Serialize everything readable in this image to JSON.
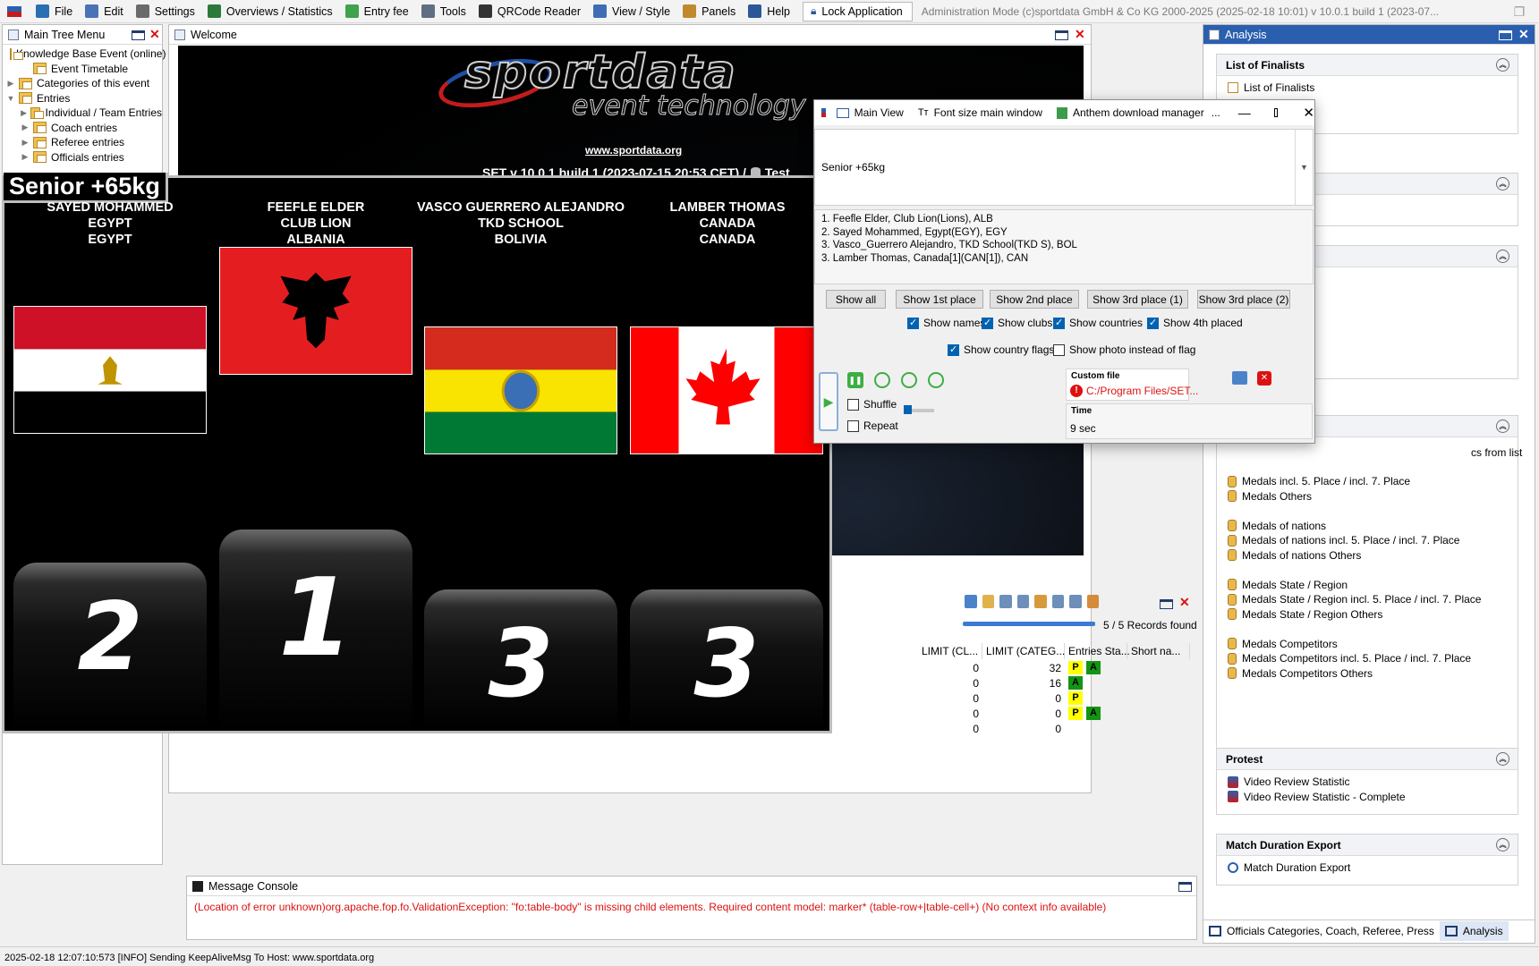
{
  "menu": {
    "items": [
      {
        "label": "File",
        "icon": "folder-icon",
        "color": "#2b6fb3"
      },
      {
        "label": "Edit",
        "icon": "edit-icon",
        "color": "#4a73b5"
      },
      {
        "label": "Settings",
        "icon": "gear-icon",
        "color": "#6a6a6a"
      },
      {
        "label": "Overviews / Statistics",
        "icon": "statistics-icon",
        "color": "#2b7a3a"
      },
      {
        "label": "Entry fee",
        "icon": "money-icon",
        "color": "#3ea34a"
      },
      {
        "label": "Tools",
        "icon": "wrench-icon",
        "color": "#5f6e82"
      },
      {
        "label": "QRCode Reader",
        "icon": "qrcode-icon",
        "color": "#333333"
      },
      {
        "label": "View / Style",
        "icon": "window-icon",
        "color": "#3f6db3"
      },
      {
        "label": "Panels",
        "icon": "panels-icon",
        "color": "#c08a2c"
      },
      {
        "label": "Help",
        "icon": "help-icon",
        "color": "#2b5797"
      }
    ],
    "lock_label": "Lock Application",
    "title": "Administration Mode (c)sportdata GmbH & Co KG 2000-2025 (2025-02-18 10:01)  v 10.0.1 build 1 (2023-07..."
  },
  "tree": {
    "title": "Main Tree Menu",
    "items": [
      {
        "label": "Knowledge Base Event (online)",
        "level": 0,
        "expander": ""
      },
      {
        "label": "Event Timetable",
        "level": 1,
        "expander": ""
      },
      {
        "label": "Categories of this event",
        "level": 0,
        "expander": "▶"
      },
      {
        "label": "Entries",
        "level": 0,
        "expander": "▼"
      },
      {
        "label": "Individual / Team Entries",
        "level": 1,
        "expander": "▶"
      },
      {
        "label": "Coach entries",
        "level": 1,
        "expander": "▶"
      },
      {
        "label": "Referee entries",
        "level": 1,
        "expander": "▶"
      },
      {
        "label": "Officials entries",
        "level": 1,
        "expander": "▶"
      }
    ]
  },
  "welcome": {
    "title": "Welcome",
    "logo_main": "sportdata",
    "logo_sub": "event technology",
    "url": "www.sportdata.org",
    "version": "SET v 10.0.1 build 1 (2023-07-15 20:53 CET) /",
    "db_label": "Test"
  },
  "scoreboard": {
    "category": "Senior +65kg",
    "competitors": [
      {
        "line1": "SAYED MOHAMMED",
        "line2": "EGYPT",
        "line3": "EGYPT",
        "place": "2",
        "flag": "egypt"
      },
      {
        "line1": "FEEFLE ELDER",
        "line2": "CLUB LION",
        "line3": "ALBANIA",
        "place": "1",
        "flag": "albania"
      },
      {
        "line1": "VASCO GUERRERO ALEJANDRO",
        "line2": "TKD SCHOOL",
        "line3": "BOLIVIA",
        "place": "3",
        "flag": "bolivia"
      },
      {
        "line1": "LAMBER THOMAS",
        "line2": "CANADA",
        "line3": "CANADA",
        "place": "3",
        "flag": "canada"
      }
    ]
  },
  "dialog": {
    "toolbar": [
      "Main View",
      "Font size main window",
      "Anthem download manager",
      "..."
    ],
    "category_select": "Senior +65kg",
    "results": [
      "1. Feefle Elder, Club Lion(Lions), ALB",
      "2. Sayed Mohammed, Egypt(EGY), EGY",
      "3. Vasco_Guerrero Alejandro, TKD School(TKD S), BOL",
      "3. Lamber Thomas, Canada[1](CAN[1]), CAN"
    ],
    "buttons": [
      "Show all",
      "Show 1st place",
      "Show 2nd place",
      "Show 3rd place (1)",
      "Show 3rd place (2)"
    ],
    "checks": {
      "names": "Show names",
      "clubs": "Show clubs",
      "countries": "Show countries",
      "fourth": "Show 4th placed",
      "flags": "Show country flags",
      "photo": "Show photo instead of flag",
      "shuffle": "Shuffle",
      "repeat": "Repeat"
    },
    "custom_file_label": "Custom file",
    "custom_file_value": "C:/Program Files/SET...",
    "time_label": "Time",
    "time_value": "9 sec"
  },
  "records": {
    "count_text": "5 / 5 Records found",
    "progress": 0.0,
    "columns": [
      "LIMIT (CL...",
      "LIMIT (CATEG...",
      "Entries Sta...",
      "Short na..."
    ],
    "rows": [
      {
        "a": "0",
        "b": "32",
        "badges": [
          "P",
          "A"
        ]
      },
      {
        "a": "0",
        "b": "16",
        "badges": [
          "A"
        ]
      },
      {
        "a": "0",
        "b": "0",
        "badges": [
          "P"
        ]
      },
      {
        "a": "0",
        "b": "0",
        "badges": [
          "P",
          "A"
        ]
      },
      {
        "a": "0",
        "b": "0",
        "badges": []
      }
    ]
  },
  "console": {
    "title": "Message Console",
    "error": "(Location of error unknown)org.apache.fop.fo.ValidationException: \"fo:table-body\" is missing child elements. Required content model: marker* (table-row+|table-cell+) (No context info available)"
  },
  "analysis": {
    "title": "Analysis",
    "finalists_header": "List of Finalists",
    "finalists_item": "List of Finalists",
    "partial_item": "cs from list",
    "medals": [
      "Medals incl. 5. Place / incl. 7. Place",
      "Medals Others",
      "",
      "Medals of nations",
      "Medals of nations incl. 5. Place / incl. 7. Place",
      "Medals of nations Others",
      "",
      "Medals State / Region",
      "Medals State / Region incl. 5. Place / incl. 7. Place",
      "Medals State / Region Others",
      "",
      "Medals Competitors",
      "Medals Competitors incl. 5. Place / incl. 7. Place",
      "Medals Competitors Others"
    ],
    "protest_header": "Protest",
    "protest_items": [
      "Video Review Statistic",
      "Video Review Statistic - Complete"
    ],
    "duration_header": "Match Duration Export",
    "duration_item": "Match Duration Export",
    "bottom_tabs": [
      "Officials Categories, Coach, Referee, Press",
      "Analysis"
    ]
  },
  "statusbar": "2025-02-18 12:07:10:573 [INFO] Sending KeepAliveMsg To Host: www.sportdata.org"
}
